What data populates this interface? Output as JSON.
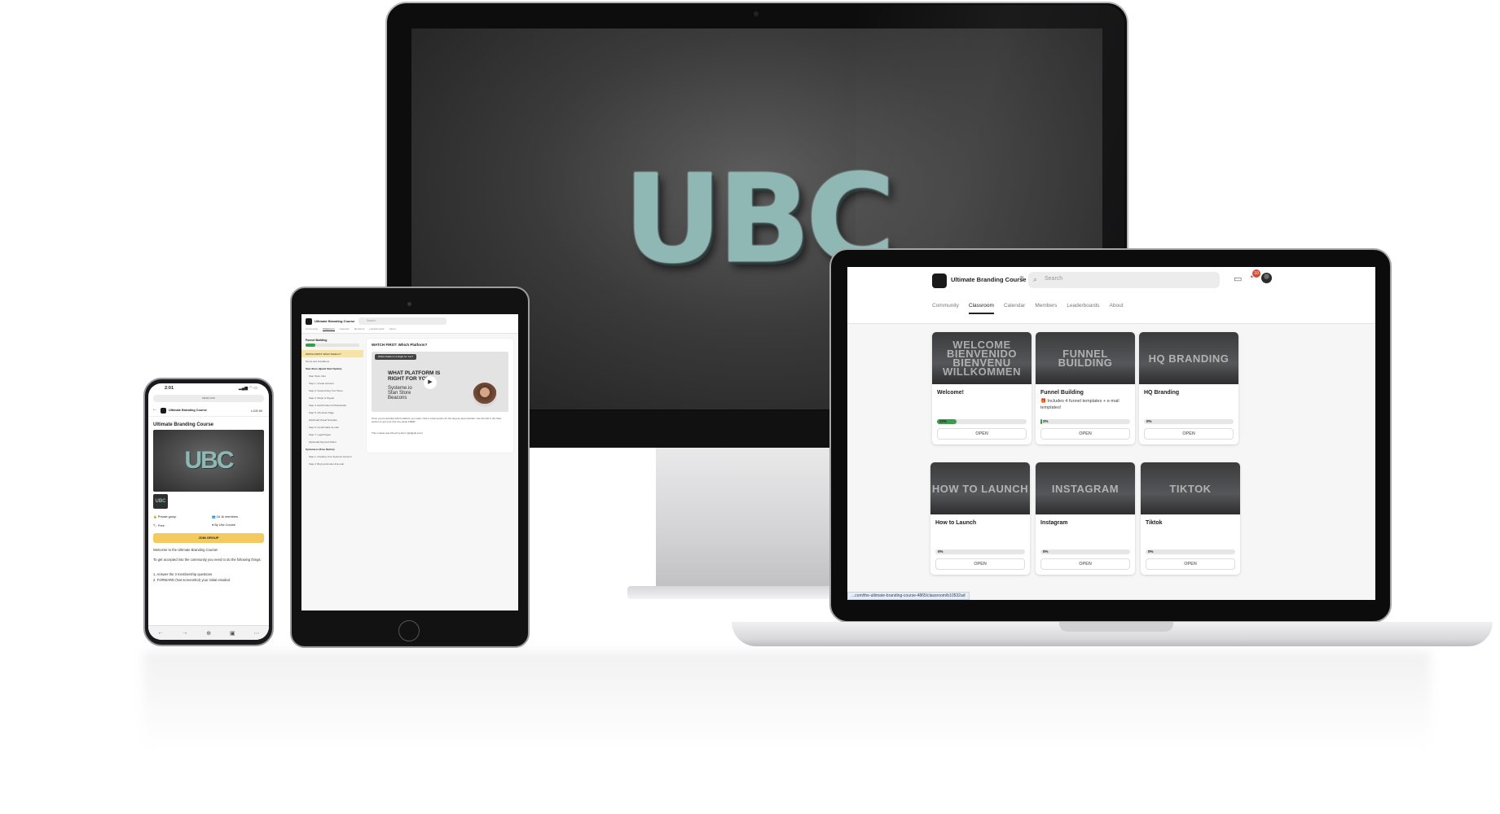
{
  "imac": {
    "logo_text": "UBC"
  },
  "laptop": {
    "app_title": "Ultimate Branding Course",
    "search_placeholder": "Search",
    "notification_count": "10",
    "tabs": [
      "Community",
      "Classroom",
      "Calendar",
      "Members",
      "Leaderboards",
      "About"
    ],
    "active_tab": "Classroom",
    "courses": [
      {
        "image_text": "WELCOME BIENVENIDO BIENVENU WILLKOMMEN",
        "title": "Welcome!",
        "description": "",
        "progress_label": "22%",
        "progress": 22,
        "button": "OPEN"
      },
      {
        "image_text": "FUNNEL BUILDING",
        "title": "Funnel Building",
        "description": "🎁 Includes 4 funnel templates + e-mail templates!",
        "progress_label": "2%",
        "progress": 2,
        "button": "OPEN"
      },
      {
        "image_text": "HQ BRANDING",
        "title": "HQ Branding",
        "description": "",
        "progress_label": "0%",
        "progress": 0,
        "button": "OPEN"
      },
      {
        "image_text": "HOW TO LAUNCH",
        "title": "How to Launch",
        "description": "",
        "progress_label": "0%",
        "progress": 0,
        "button": "OPEN"
      },
      {
        "image_text": "INSTAGRAM",
        "title": "Instagram",
        "description": "",
        "progress_label": "0%",
        "progress": 0,
        "button": "OPEN"
      },
      {
        "image_text": "TIKTOK",
        "title": "Tiktok",
        "description": "",
        "progress_label": "0%",
        "progress": 0,
        "button": "OPEN"
      }
    ],
    "status_url": "...com/the-ultimate-branding-course-4865/classroom/b10532ad"
  },
  "tablet": {
    "app_title": "Ultimate Branding Course",
    "search_placeholder": "Search",
    "tabs": [
      "Community",
      "Classroom",
      "Calendar",
      "Members",
      "Leaderboards",
      "About"
    ],
    "active_tab": "Classroom",
    "sidebar": {
      "course_title": "Funnel Building",
      "items": [
        {
          "label": "WATCH FIRST: Which Platform?",
          "kind": "active"
        },
        {
          "label": "Terms and Conditions",
          "kind": "normal"
        },
        {
          "label": "Stan Store (Quick Start Option)",
          "kind": "sec"
        },
        {
          "label": "Stan Store Intro",
          "kind": "sub"
        },
        {
          "label": "Step 1: Create Account",
          "kind": "sub"
        },
        {
          "label": "Step 2: Customizing Your Store",
          "kind": "sub"
        },
        {
          "label": "Step 3: Stripe & Paypal",
          "kind": "sub"
        },
        {
          "label": "Step 4: Add Product & Placeholder",
          "kind": "sub"
        },
        {
          "label": "Step 5: Checkout Page",
          "kind": "sub"
        },
        {
          "label": "[Optional] Visual Template",
          "kind": "sub"
        },
        {
          "label": "Step 6: Confirmation E-mail",
          "kind": "sub"
        },
        {
          "label": "Step 7: Legal Pages",
          "kind": "sub"
        },
        {
          "label": "[Optional] Payment Plans",
          "kind": "sub"
        },
        {
          "label": "Systeme.io (Free Option)",
          "kind": "sec"
        },
        {
          "label": "Step 1: Creating Your Systeme Account",
          "kind": "sub"
        },
        {
          "label": "Step 2: Buying Domain & E-mail",
          "kind": "sub"
        }
      ]
    },
    "lesson": {
      "title": "WATCH FIRST: Which Platform?",
      "video_bar": "Which Platform is Right for You?",
      "video_heading_1": "WHAT PLATFORM IS",
      "video_heading_2": "RIGHT FOR YOU?",
      "video_options": [
        "Systeme.io",
        "Stan Store",
        "Beacons"
      ],
      "body_1": "Once you've decided which platform you want, click on that section for the step-by-step tutorials. Use the link in the Stan section to get your first one-week FREE!",
      "body_2": "This module was filmed by Erez (@digital.erez)"
    }
  },
  "phone": {
    "time": "2:01",
    "status_icons": "▂▄▆ ◠ ▭",
    "url": "skool.com",
    "app_title": "Ultimate Branding Course",
    "login": "LOG IN",
    "heading": "Ultimate Branding Course",
    "hero_text": "UBC",
    "thumb_text": "UBC",
    "private": "Private group",
    "members": "16.1k members",
    "price": "Free",
    "owner": "By Ubc Course",
    "join": "JOIN GROUP",
    "welcome": "Welcome to the Ultimate Branding Course!",
    "instructions": "To get accepted into the community you need to do the following things:",
    "step_1": "1. Answer the 3 membership questions",
    "step_2": "2. FORWARD (Not screenshot) your initial emailed"
  }
}
